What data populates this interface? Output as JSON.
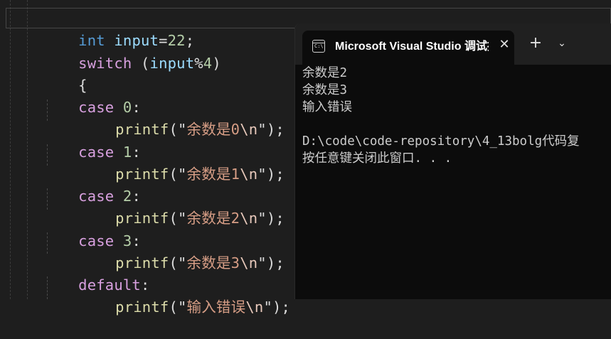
{
  "editor": {
    "lines": [
      {
        "kw": "int",
        "ident": "input",
        "op": "=",
        "num": "22",
        "end": ";"
      },
      {
        "kw": "switch",
        "open": " (",
        "ident": "input",
        "op": "%",
        "num": "4",
        "close": ")"
      },
      {
        "brace": "{"
      },
      {
        "kw": "case",
        "num": "0",
        "colon": ":"
      },
      {
        "fn": "printf",
        "open": "(\"",
        "str": "余数是0",
        "esc": "\\n",
        "close": "\");"
      },
      {
        "kw": "case",
        "num": "1",
        "colon": ":"
      },
      {
        "fn": "printf",
        "open": "(\"",
        "str": "余数是1",
        "esc": "\\n",
        "close": "\");"
      },
      {
        "kw": "case",
        "num": "2",
        "colon": ":"
      },
      {
        "fn": "printf",
        "open": "(\"",
        "str": "余数是2",
        "esc": "\\n",
        "close": "\");"
      },
      {
        "kw": "case",
        "num": "3",
        "colon": ":"
      },
      {
        "fn": "printf",
        "open": "(\"",
        "str": "余数是3",
        "esc": "\\n",
        "close": "\");"
      },
      {
        "kw": "default",
        "colon": ":"
      },
      {
        "fn": "printf",
        "open": "(\"",
        "str": "输入错误",
        "esc": "\\n",
        "close": "\");"
      }
    ]
  },
  "terminal": {
    "tab_title": "Microsoft Visual Studio 调试控",
    "tab_icon_text": "C:\\",
    "close_glyph": "✕",
    "new_tab_glyph": "+",
    "dropdown_glyph": "⌄",
    "output": [
      "余数是2",
      "余数是3",
      "输入错误",
      "",
      "D:\\code\\code-repository\\4_13bolg代码复",
      "按任意键关闭此窗口. . ."
    ]
  },
  "colors": {
    "editor_bg": "#1e1e1e",
    "terminal_bg": "#0c0c0c",
    "keyword": "#569cd6",
    "control_keyword": "#d8a0df",
    "identifier": "#9cdcfe",
    "number": "#b5cea8",
    "function": "#dcdcaa",
    "string": "#d69d85"
  }
}
